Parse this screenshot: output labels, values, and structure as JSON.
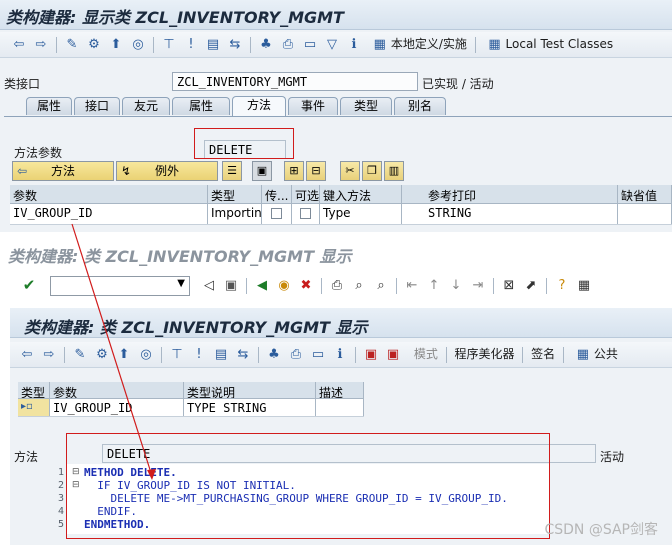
{
  "top": {
    "title": "类构建器: 显示类 ZCL_INVENTORY_MGMT",
    "toolbar_local": "本地定义/实施",
    "toolbar_local_test": "Local Test Classes",
    "class_iface_label": "类接口",
    "class_name": "ZCL_INVENTORY_MGMT",
    "status": "已实现 / 活动",
    "tabs": [
      "属性",
      "接口",
      "友元",
      "属性",
      "方法",
      "事件",
      "类型",
      "别名"
    ],
    "method_param_label": "方法参数",
    "method_param_value": "DELETE",
    "btn_method": "方法",
    "btn_exception": "例外",
    "grid_headers": [
      "参数",
      "类型",
      "传...",
      "可选",
      "键入方法",
      "参考打印",
      "缺省值"
    ],
    "grid_row": {
      "param": "IV_GROUP_ID",
      "type": "Importin...",
      "typing": "Type",
      "ref": "STRING"
    }
  },
  "mid": {
    "title": "类 ZCL_INVENTORY_MGMT 显示"
  },
  "bottom": {
    "title": "类构建器: 类 ZCL_INVENTORY_MGMT 显示",
    "toolbar_mode": "模式",
    "toolbar_pretty": "程序美化器",
    "toolbar_sign": "签名",
    "toolbar_public": "公共",
    "param_headers": [
      "类型",
      "参数",
      "类型说明",
      "描述"
    ],
    "param_row": {
      "param": "IV_GROUP_ID",
      "typedesc": "TYPE STRING"
    },
    "method_label": "方法",
    "method_value": "DELETE",
    "method_status": "活动",
    "code_lines": [
      {
        "num": "1",
        "text": "METHOD DELETE."
      },
      {
        "num": "2",
        "text": "  IF IV_GROUP_ID IS NOT INITIAL."
      },
      {
        "num": "3",
        "text": "    DELETE ME->MT_PURCHASING_GROUP WHERE GROUP_ID = IV_GROUP_ID."
      },
      {
        "num": "4",
        "text": "  ENDIF."
      },
      {
        "num": "5",
        "text": "ENDMETHOD."
      }
    ]
  },
  "watermark": "CSDN @SAP剑客",
  "colors": {
    "highlight": "#d11c1c",
    "keyword": "#1b2fb3"
  }
}
